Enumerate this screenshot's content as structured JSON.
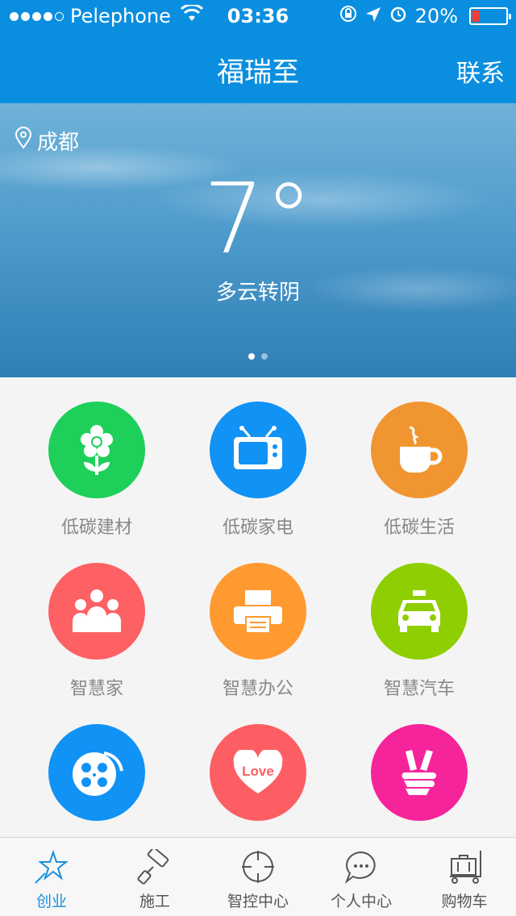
{
  "status": {
    "carrier": "Pelephone",
    "time": "03:36",
    "battery": "20%",
    "battery_level": 0.2,
    "signal_bars": 4
  },
  "nav": {
    "title": "福瑞至",
    "contact": "联系"
  },
  "weather": {
    "city": "成都",
    "temp": "7°",
    "desc": "多云转阴",
    "page": 1,
    "pages": 2
  },
  "grid": [
    {
      "label": "低碳建材",
      "color": "#1ed05a",
      "icon": "flower-icon"
    },
    {
      "label": "低碳家电",
      "color": "#1192f5",
      "icon": "tv-icon"
    },
    {
      "label": "低碳生活",
      "color": "#f19531",
      "icon": "coffee-icon"
    },
    {
      "label": "智慧家",
      "color": "#fd6164",
      "icon": "family-icon"
    },
    {
      "label": "智慧办公",
      "color": "#ff9a31",
      "icon": "printer-icon"
    },
    {
      "label": "智慧汽车",
      "color": "#8fce00",
      "icon": "taxi-icon"
    },
    {
      "label": "",
      "color": "#1192f5",
      "icon": "film-reel-icon"
    },
    {
      "label": "",
      "color": "#fd5e63",
      "icon": "love-heart-icon",
      "badge": "Love"
    },
    {
      "label": "",
      "color": "#f6249b",
      "icon": "peace-hand-icon"
    }
  ],
  "tabs": [
    {
      "label": "创业",
      "icon": "star-wand-icon",
      "active": true
    },
    {
      "label": "施工",
      "icon": "paint-roller-icon",
      "active": false
    },
    {
      "label": "智控中心",
      "icon": "crosshair-icon",
      "active": false
    },
    {
      "label": "个人中心",
      "icon": "chat-bubble-icon",
      "active": false
    },
    {
      "label": "购物车",
      "icon": "luggage-cart-icon",
      "active": false
    }
  ]
}
